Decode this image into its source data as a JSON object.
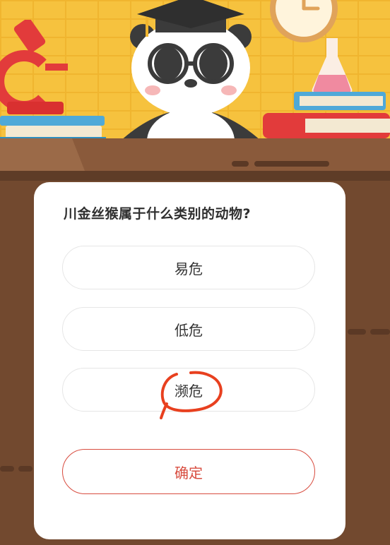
{
  "quiz": {
    "question": "川金丝猴属于什么类别的动物?",
    "options": [
      {
        "label": "易危"
      },
      {
        "label": "低危"
      },
      {
        "label": "濒危"
      }
    ],
    "confirm_label": "确定"
  },
  "colors": {
    "wall": "#f6c23e",
    "desk": "#72492f",
    "accent": "#d84c3f",
    "annotation": "#e8401f"
  }
}
